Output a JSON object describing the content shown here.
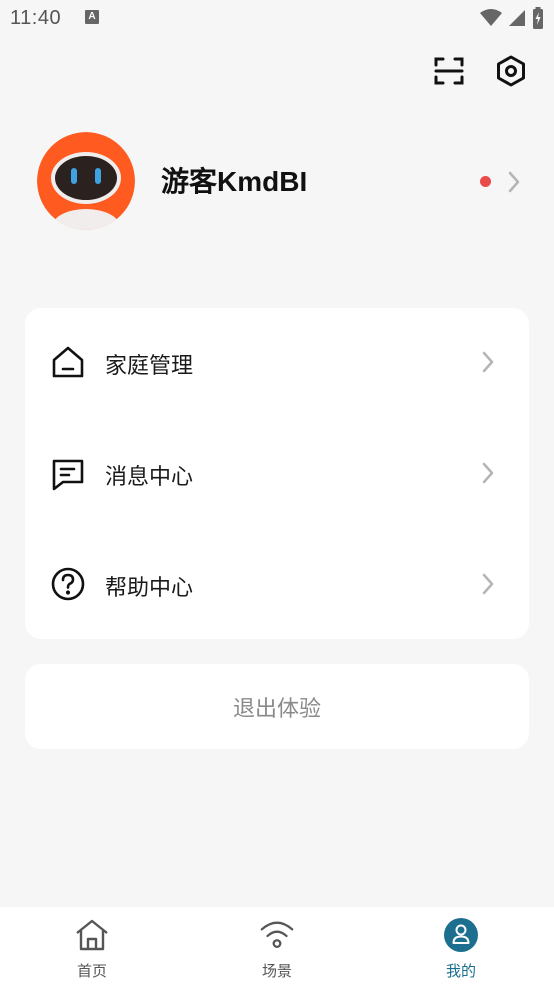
{
  "status_bar": {
    "time": "11:40",
    "notification_icon": "A"
  },
  "top_actions": {
    "scan_icon": "scan-icon",
    "settings_icon": "settings-icon"
  },
  "profile": {
    "username": "游客KmdBI",
    "unread_indicator_color": "#e94b4b"
  },
  "menu": {
    "items": [
      {
        "label": "家庭管理",
        "icon": "home-icon"
      },
      {
        "label": "消息中心",
        "icon": "message-icon"
      },
      {
        "label": "帮助中心",
        "icon": "help-icon"
      }
    ]
  },
  "logout": {
    "label": "退出体验"
  },
  "bottom_nav": {
    "items": [
      {
        "label": "首页",
        "icon": "home-icon",
        "active": false
      },
      {
        "label": "场景",
        "icon": "wifi-icon",
        "active": false
      },
      {
        "label": "我的",
        "icon": "user-icon",
        "active": true
      }
    ],
    "accent_color": "#1d6f8f"
  }
}
